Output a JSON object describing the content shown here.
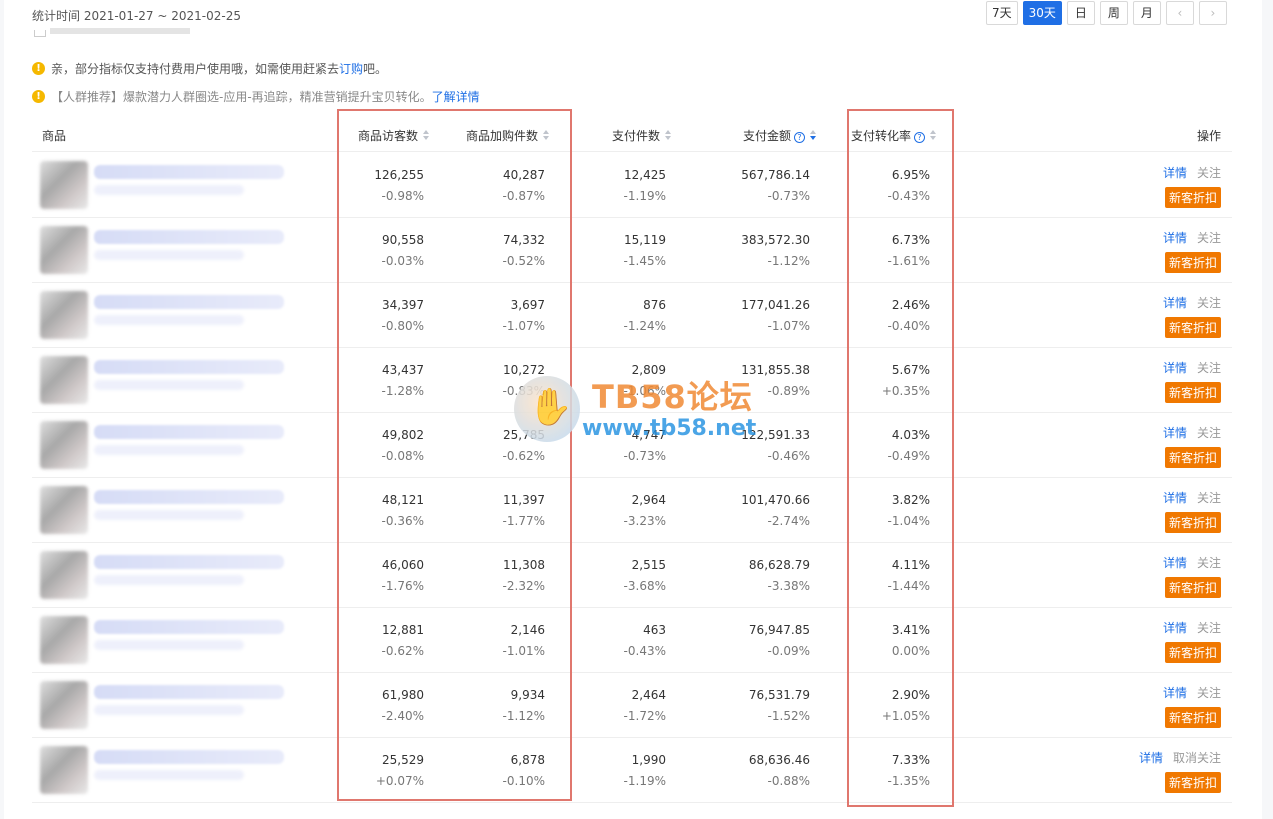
{
  "header": {
    "period_label": "统计时间 2021-01-27 ~ 2021-02-25",
    "range_buttons": [
      "7天",
      "30天",
      "日",
      "周",
      "月"
    ],
    "active_range": "30天",
    "prev_icon": "chevron-left-icon",
    "next_icon": "chevron-right-icon"
  },
  "notices": {
    "paid": {
      "prefix": "亲，部分指标仅支持付费用户使用哦，如需使用赶紧去 ",
      "link": "订购",
      "suffix": "吧。"
    },
    "crowd": {
      "text": "【人群推荐】爆款潜力人群圈选-应用-再追踪，精准营销提升宝贝转化。",
      "link": "了解详情"
    }
  },
  "table": {
    "headers": {
      "product": "商品",
      "visitors": "商品访客数",
      "cart": "商品加购件数",
      "paid_items": "支付件数",
      "paid_amount": "支付金额",
      "conversion": "支付转化率",
      "actions": "操作"
    },
    "rows": [
      {
        "visitors": "126,255",
        "visitors_chg": "-0.98%",
        "cart": "40,287",
        "cart_chg": "-0.87%",
        "items": "12,425",
        "items_chg": "-1.19%",
        "amount": "567,786.14",
        "amount_chg": "-0.73%",
        "conv": "6.95%",
        "conv_chg": "-0.43%",
        "detail": "详情",
        "follow": "关注",
        "badge": "新客折扣"
      },
      {
        "visitors": "90,558",
        "visitors_chg": "-0.03%",
        "cart": "74,332",
        "cart_chg": "-0.52%",
        "items": "15,119",
        "items_chg": "-1.45%",
        "amount": "383,572.30",
        "amount_chg": "-1.12%",
        "conv": "6.73%",
        "conv_chg": "-1.61%",
        "detail": "详情",
        "follow": "关注",
        "badge": "新客折扣"
      },
      {
        "visitors": "34,397",
        "visitors_chg": "-0.80%",
        "cart": "3,697",
        "cart_chg": "-1.07%",
        "items": "876",
        "items_chg": "-1.24%",
        "amount": "177,041.26",
        "amount_chg": "-1.07%",
        "conv": "2.46%",
        "conv_chg": "-0.40%",
        "detail": "详情",
        "follow": "关注",
        "badge": "新客折扣"
      },
      {
        "visitors": "43,437",
        "visitors_chg": "-1.28%",
        "cart": "10,272",
        "cart_chg": "-0.83%",
        "items": "2,809",
        "items_chg": "-1.06%",
        "amount": "131,855.38",
        "amount_chg": "-0.89%",
        "conv": "5.67%",
        "conv_chg": "+0.35%",
        "detail": "详情",
        "follow": "关注",
        "badge": "新客折扣"
      },
      {
        "visitors": "49,802",
        "visitors_chg": "-0.08%",
        "cart": "25,785",
        "cart_chg": "-0.62%",
        "items": "4,747",
        "items_chg": "-0.73%",
        "amount": "122,591.33",
        "amount_chg": "-0.46%",
        "conv": "4.03%",
        "conv_chg": "-0.49%",
        "detail": "详情",
        "follow": "关注",
        "badge": "新客折扣"
      },
      {
        "visitors": "48,121",
        "visitors_chg": "-0.36%",
        "cart": "11,397",
        "cart_chg": "-1.77%",
        "items": "2,964",
        "items_chg": "-3.23%",
        "amount": "101,470.66",
        "amount_chg": "-2.74%",
        "conv": "3.82%",
        "conv_chg": "-1.04%",
        "detail": "详情",
        "follow": "关注",
        "badge": "新客折扣"
      },
      {
        "visitors": "46,060",
        "visitors_chg": "-1.76%",
        "cart": "11,308",
        "cart_chg": "-2.32%",
        "items": "2,515",
        "items_chg": "-3.68%",
        "amount": "86,628.79",
        "amount_chg": "-3.38%",
        "conv": "4.11%",
        "conv_chg": "-1.44%",
        "detail": "详情",
        "follow": "关注",
        "badge": "新客折扣"
      },
      {
        "visitors": "12,881",
        "visitors_chg": "-0.62%",
        "cart": "2,146",
        "cart_chg": "-1.01%",
        "items": "463",
        "items_chg": "-0.43%",
        "amount": "76,947.85",
        "amount_chg": "-0.09%",
        "conv": "3.41%",
        "conv_chg": "0.00%",
        "detail": "详情",
        "follow": "关注",
        "badge": "新客折扣"
      },
      {
        "visitors": "61,980",
        "visitors_chg": "-2.40%",
        "cart": "9,934",
        "cart_chg": "-1.12%",
        "items": "2,464",
        "items_chg": "-1.72%",
        "amount": "76,531.79",
        "amount_chg": "-1.52%",
        "conv": "2.90%",
        "conv_chg": "+1.05%",
        "detail": "详情",
        "follow": "关注",
        "badge": "新客折扣"
      },
      {
        "visitors": "25,529",
        "visitors_chg": "+0.07%",
        "cart": "6,878",
        "cart_chg": "-0.10%",
        "items": "1,990",
        "items_chg": "-1.19%",
        "amount": "68,636.46",
        "amount_chg": "-0.88%",
        "conv": "7.33%",
        "conv_chg": "-1.35%",
        "detail": "详情",
        "follow": "取消关注",
        "badge": "新客折扣"
      }
    ]
  },
  "watermark": {
    "title": "TB58论坛",
    "url": "www.tb58.net",
    "icon": "hand-logo-icon"
  },
  "colors": {
    "accent": "#1f6fe5",
    "badge": "#f07800",
    "highlight_box": "#e0776e"
  }
}
